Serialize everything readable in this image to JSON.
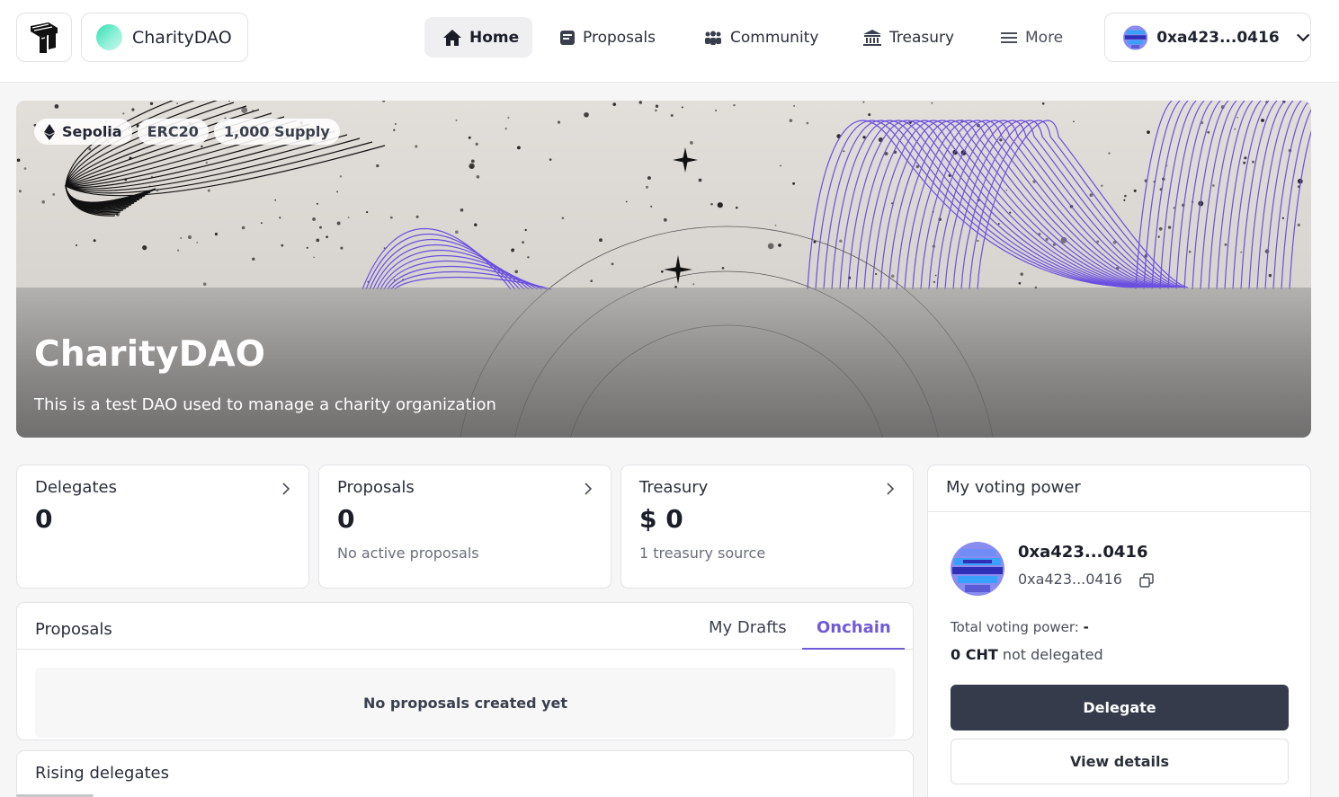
{
  "nav": {
    "dao_name": "CharityDAO",
    "items": [
      {
        "label": "Home",
        "icon": "home-icon",
        "active": true
      },
      {
        "label": "Proposals",
        "icon": "proposals-icon"
      },
      {
        "label": "Community",
        "icon": "community-icon"
      },
      {
        "label": "Treasury",
        "icon": "bank-icon"
      },
      {
        "label": "More",
        "icon": "menu-icon"
      }
    ],
    "account": "0xa423...0416"
  },
  "hero": {
    "badges": [
      "Sepolia",
      "ERC20",
      "1,000 Supply"
    ],
    "title": "CharityDAO",
    "description": "This is a test DAO used to manage a charity organization"
  },
  "stats": {
    "delegates": {
      "label": "Delegates",
      "value": "0"
    },
    "proposals": {
      "label": "Proposals",
      "value": "0",
      "sub": "No active proposals"
    },
    "treasury": {
      "label": "Treasury",
      "value": "$ 0",
      "sub": "1 treasury source"
    }
  },
  "proposals_panel": {
    "title": "Proposals",
    "tabs": [
      "My Drafts",
      "Onchain"
    ],
    "active_tab": "Onchain",
    "empty_text": "No proposals created yet"
  },
  "rising_delegates": {
    "title": "Rising delegates"
  },
  "voting_power": {
    "title": "My voting power",
    "name": "0xa423...0416",
    "address": "0xa423...0416",
    "total_label": "Total voting power:",
    "total_value": "-",
    "not_delegated_amount": "0 CHT",
    "not_delegated_text": "not delegated",
    "delegate_button": "Delegate",
    "details_button": "View details"
  },
  "colors": {
    "accent": "#6e5bd8",
    "primary_button": "#353b4b",
    "hero_lines": "#6b4fe0"
  }
}
